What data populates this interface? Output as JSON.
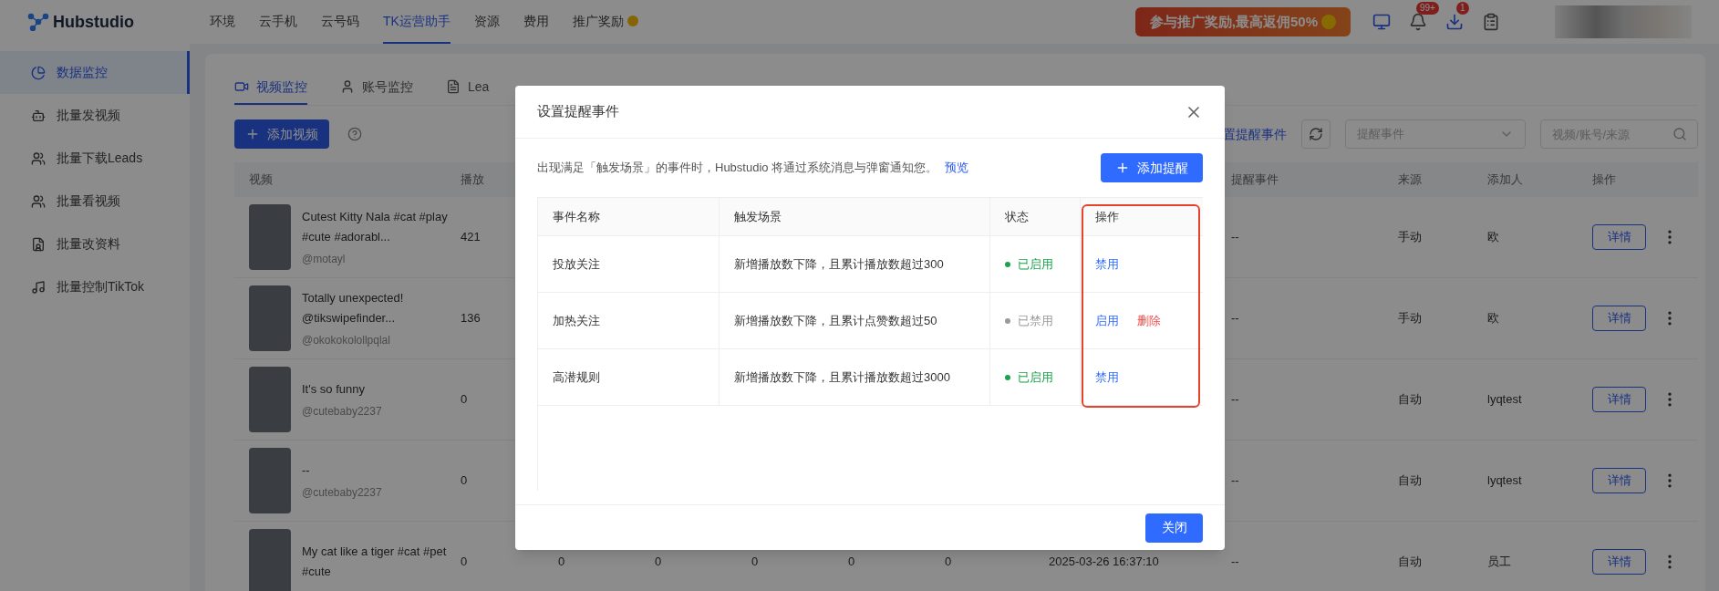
{
  "topbar": {
    "logo": "Hubstudio",
    "nav": [
      {
        "label": "环境",
        "selected": false,
        "kind": "plain"
      },
      {
        "label": "云手机",
        "selected": false,
        "kind": "plain"
      },
      {
        "label": "云号码",
        "selected": false,
        "kind": "plain"
      },
      {
        "label": "TK运营助手",
        "selected": true,
        "kind": "plain"
      },
      {
        "label": "资源",
        "selected": false,
        "kind": "plain"
      },
      {
        "label": "费用",
        "selected": false,
        "kind": "plain"
      },
      {
        "label": "推广奖励",
        "selected": false,
        "kind": "reward"
      }
    ],
    "promo": "参与推广奖励,最高返佣50%",
    "notifications_badge": "99+",
    "downloads_badge": "1"
  },
  "sidebar": {
    "items": [
      {
        "label": "数据监控",
        "selected": true
      },
      {
        "label": "批量发视频",
        "selected": false
      },
      {
        "label": "批量下载Leads",
        "selected": false
      },
      {
        "label": "批量看视频",
        "selected": false
      },
      {
        "label": "批量改资料",
        "selected": false
      },
      {
        "label": "批量控制TikTok",
        "selected": false
      }
    ]
  },
  "main": {
    "tabs": [
      {
        "label": "视频监控",
        "selected": true
      },
      {
        "label": "账号监控",
        "selected": false
      },
      {
        "label": "Lea",
        "selected": false
      }
    ],
    "add_button": "添加视频",
    "settings_link": "置提醒事件",
    "event_select": {
      "placeholder": "提醒事件"
    },
    "search": {
      "placeholder": "视频/账号/来源"
    },
    "table": {
      "columns": {
        "video": "视频",
        "plays": "播放",
        "event": "提醒事件",
        "source": "来源",
        "adder": "添加人",
        "actions": "操作"
      },
      "rows": [
        {
          "title": "Cutest Kitty Nala #cat #play #cute #adorabl...",
          "author": "@motayl",
          "plays": "421",
          "event": "--",
          "source": "手动",
          "adder": "欧",
          "detail": "详情"
        },
        {
          "title": "Totally unexpected! @tikswipefinder...",
          "author": "@okokokolollpqlal",
          "plays": "136",
          "event": "--",
          "source": "手动",
          "adder": "欧",
          "detail": "详情"
        },
        {
          "title": "It's so funny",
          "author": "@cutebaby2237",
          "plays": "0",
          "event": "--",
          "source": "自动",
          "adder": "lyqtest",
          "detail": "详情"
        },
        {
          "title": "--",
          "author": "@cutebaby2237",
          "plays": "0",
          "event": "--",
          "source": "自动",
          "adder": "lyqtest",
          "detail": "详情"
        },
        {
          "title": "My cat like a tiger #cat #pet #cute",
          "plays": "0",
          "metrics": [
            "0",
            "0",
            "0",
            "0",
            "0"
          ],
          "time": "2025-03-26 16:37:10",
          "event": "--",
          "source": "自动",
          "adder": "员工",
          "detail": "详情"
        }
      ]
    }
  },
  "dialog": {
    "title": "设置提醒事件",
    "description": "出现满足「触发场景」的事件时，Hubstudio 将通过系统消息与弹窗通知您。",
    "preview_link": "预览",
    "add_button": "添加提醒",
    "actions_column_highlighted": true,
    "columns": [
      "事件名称",
      "触发场景",
      "状态",
      "操作"
    ],
    "rows": [
      {
        "name": "投放关注",
        "trigger": "新增播放数下降，且累计播放数超过300",
        "enabled": true,
        "status": "已启用",
        "actions": [
          {
            "kind": "toggle",
            "label": "禁用"
          }
        ]
      },
      {
        "name": "加热关注",
        "trigger": "新增播放数下降，且累计点赞数超过50",
        "enabled": false,
        "status": "已禁用",
        "actions": [
          {
            "kind": "toggle",
            "label": "启用"
          },
          {
            "kind": "delete",
            "label": "删除"
          }
        ]
      },
      {
        "name": "高潜规则",
        "trigger": "新增播放数下降，且累计播放数超过3000",
        "enabled": true,
        "status": "已启用",
        "actions": [
          {
            "kind": "toggle",
            "label": "禁用"
          }
        ]
      }
    ],
    "close_button": "关闭"
  }
}
